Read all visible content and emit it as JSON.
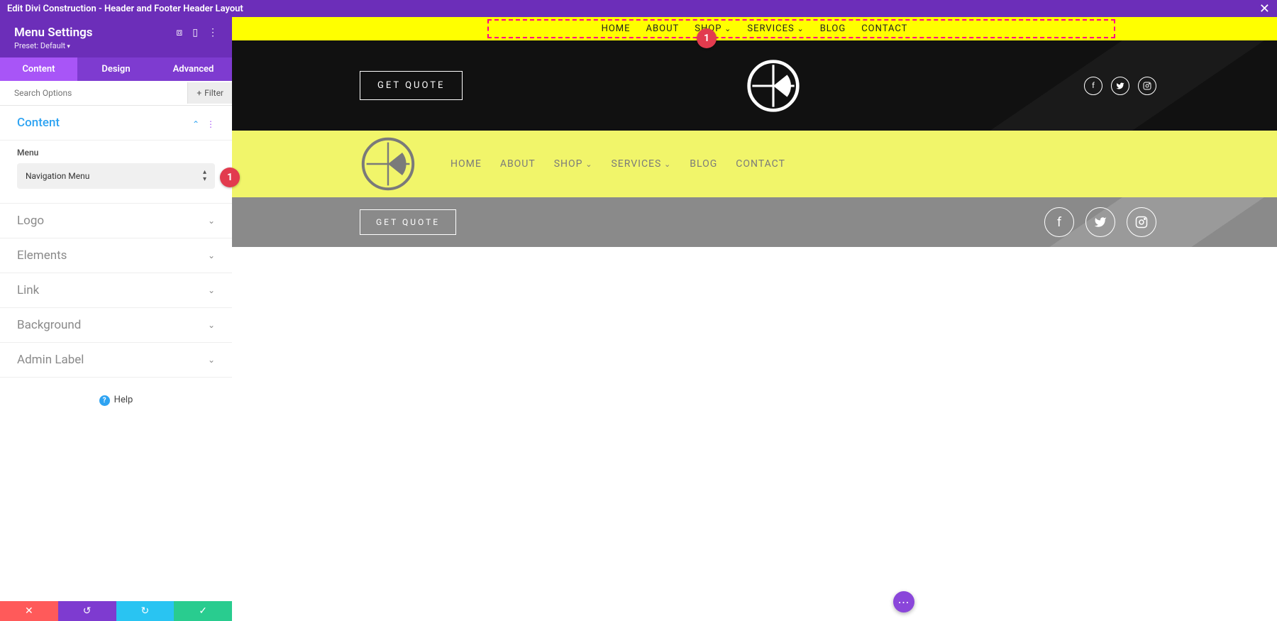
{
  "topbar": {
    "title": "Edit Divi Construction - Header and Footer Header Layout"
  },
  "sidebar": {
    "title": "Menu Settings",
    "preset": "Preset: Default",
    "tabs": [
      "Content",
      "Design",
      "Advanced"
    ],
    "active_tab": 0,
    "search_placeholder": "Search Options",
    "filter_label": "Filter",
    "sections": {
      "content": {
        "label": "Content",
        "open": true,
        "field_label": "Menu",
        "select_value": "Navigation Menu"
      },
      "logo": {
        "label": "Logo"
      },
      "elements": {
        "label": "Elements"
      },
      "link": {
        "label": "Link"
      },
      "background": {
        "label": "Background"
      },
      "admin_label": {
        "label": "Admin Label"
      }
    },
    "help_label": "Help"
  },
  "canvas": {
    "nav1_items": [
      {
        "label": "HOME"
      },
      {
        "label": "ABOUT"
      },
      {
        "label": "SHOP",
        "dropdown": true
      },
      {
        "label": "SERVICES",
        "dropdown": true
      },
      {
        "label": "BLOG"
      },
      {
        "label": "CONTACT"
      }
    ],
    "quote_label": "GET QUOTE",
    "nav2_items": [
      {
        "label": "HOME"
      },
      {
        "label": "ABOUT"
      },
      {
        "label": "SHOP",
        "dropdown": true
      },
      {
        "label": "SERVICES",
        "dropdown": true
      },
      {
        "label": "BLOG"
      },
      {
        "label": "CONTACT"
      }
    ],
    "quote_label2": "GET QUOTE",
    "badge_1": "1",
    "badge_2": "1"
  }
}
